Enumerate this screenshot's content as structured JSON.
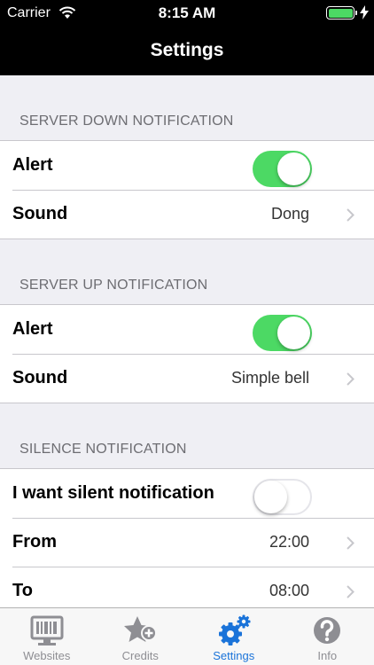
{
  "status_bar": {
    "carrier": "Carrier",
    "time": "8:15 AM"
  },
  "nav": {
    "title": "Settings"
  },
  "sections": [
    {
      "header": "SERVER DOWN NOTIFICATION",
      "alert_label": "Alert",
      "alert_on": true,
      "sound_label": "Sound",
      "sound_value": "Dong"
    },
    {
      "header": "SERVER UP NOTIFICATION",
      "alert_label": "Alert",
      "alert_on": true,
      "sound_label": "Sound",
      "sound_value": "Simple bell"
    },
    {
      "header": "SILENCE NOTIFICATION",
      "silent_label": "I want silent notification",
      "silent_on": false,
      "from_label": "From",
      "from_value": "22:00",
      "to_label": "To",
      "to_value": "08:00"
    }
  ],
  "tabs": [
    {
      "label": "Websites",
      "icon": "websites-icon",
      "active": false
    },
    {
      "label": "Credits",
      "icon": "star-plus-icon",
      "active": false
    },
    {
      "label": "Settings",
      "icon": "gears-icon",
      "active": true
    },
    {
      "label": "Info",
      "icon": "question-icon",
      "active": false
    }
  ],
  "colors": {
    "accent": "#1a73d9",
    "switch_on": "#4cd964",
    "bar": "#000000",
    "background": "#efeff4"
  }
}
